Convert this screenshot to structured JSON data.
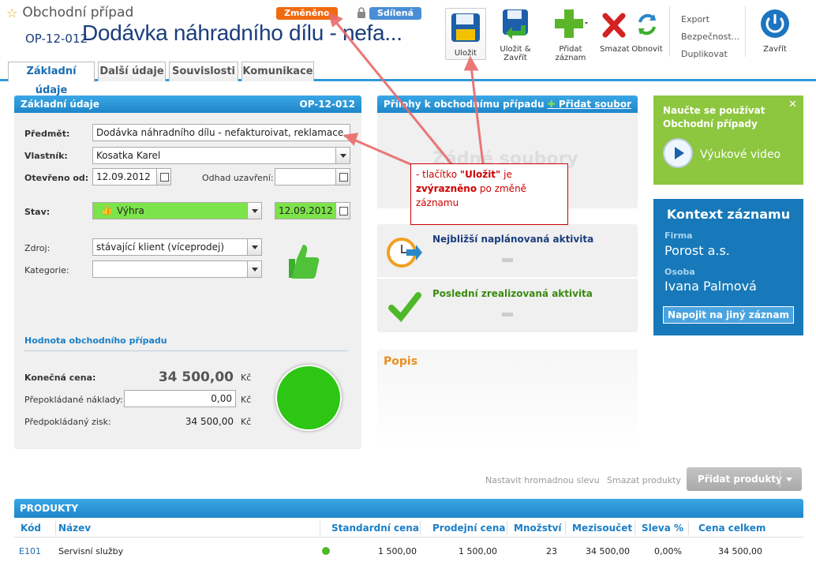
{
  "header": {
    "module_title": "Obchodní případ",
    "badge_changed": "Změněno",
    "badge_shared": "Sdílená",
    "record_id": "OP-12-012",
    "record_title": "Dodávka náhradního dílu - nefa..."
  },
  "toolbar": {
    "save": "Uložit",
    "save_close": "Uložit & Zavřít",
    "add_record": "Přidat záznam",
    "delete": "Smazat",
    "refresh": "Obnovit",
    "export": "Export",
    "security": "Bezpečnost...",
    "duplicate": "Duplikovat",
    "close": "Zavřít"
  },
  "tabs": [
    "Základní údaje",
    "Další údaje",
    "Souvislosti",
    "Komunikace"
  ],
  "basic": {
    "title": "Základní údaje",
    "record_id": "OP-12-012",
    "subject_label": "Předmět:",
    "subject_value": "Dodávka náhradního dílu - nefakturoivat, reklamace, iuhi",
    "owner_label": "Vlastník:",
    "owner_value": "Kosatka Karel",
    "opened_label": "Otevřeno od:",
    "opened_value": "12.09.2012",
    "close_est_label": "Odhad uzavření:",
    "close_est_value": "",
    "status_label": "Stav:",
    "status_value": "Výhra",
    "status_date": "12.09.2012",
    "source_label": "Zdroj:",
    "source_value": "stávající klient (víceprodej)",
    "category_label": "Kategorie:",
    "category_value": "",
    "value_section": "Hodnota obchodního případu",
    "final_price_label": "Konečná cena:",
    "final_price_value": "34 500,00",
    "cost_label": "Přepokládané náklady:",
    "cost_value": "0,00",
    "profit_label": "Předpokládaný zisk:",
    "profit_value": "34 500,00",
    "currency": "Kč"
  },
  "attachments": {
    "title": "Přílohy k obchodnímu případu",
    "add_file": "Přidat soubor",
    "empty": "Žádné soubory"
  },
  "annotation": {
    "prefix": "- tlačítko ",
    "button": "\"Uložit\"",
    "mid": " je ",
    "highlight": "zvýrazněno",
    "suffix": " po změně záznamu"
  },
  "activities": {
    "next_title": "Nejbližší naplánovaná aktivita",
    "last_title": "Poslední zrealizovaná aktivita"
  },
  "description": {
    "title": "Popis"
  },
  "learn": {
    "title": "Naučte se používat Obchodní případy",
    "video": "Výukové video"
  },
  "context": {
    "title": "Kontext záznamu",
    "company_label": "Firma",
    "company_value": "Porost a.s.",
    "person_label": "Osoba",
    "person_value": "Ivana Palmová",
    "link_button": "Napojit na jiný záznam"
  },
  "products": {
    "mass_discount": "Nastavit hromadnou slevu",
    "delete_products": "Smazat produkty",
    "add_products": "Přidat produkty",
    "title": "PRODUKTY",
    "columns": [
      "Kód",
      "Název",
      "Standardní cena",
      "Prodejní cena",
      "Množství",
      "Mezisoučet",
      "Sleva %",
      "Cena celkem"
    ],
    "row": {
      "code": "E101",
      "name": "Servisní služby",
      "std_price": "1 500,00",
      "sale_price": "1 500,00",
      "qty": "23",
      "subtotal": "34 500,00",
      "discount": "0,00%",
      "total": "34 500,00"
    }
  },
  "colors": {
    "accent": "#2f9ad9",
    "win_green": "#7de34a",
    "changed": "#f06a10",
    "annotation": "#cc0000"
  }
}
